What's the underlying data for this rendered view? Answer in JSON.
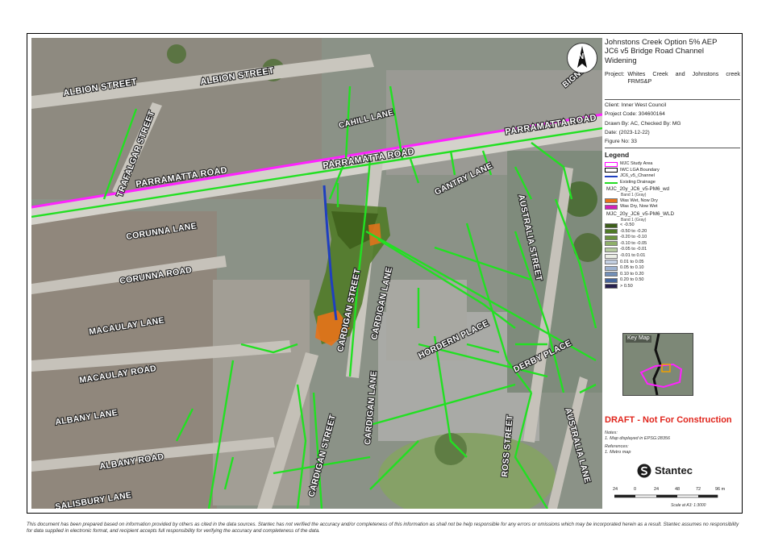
{
  "title": {
    "line1": "Johnstons Creek Option 5% AEP",
    "line2": "JC6 v5 Bridge Road Channel",
    "line3": "Widening"
  },
  "project": {
    "label": "Project:",
    "value": "Whites Creek and Johnstons creek FRMS&P"
  },
  "client": {
    "label": "Client:",
    "value": "Inner West Council"
  },
  "project_code": {
    "label": "Project Code:",
    "value": "304600164"
  },
  "drawn_by": {
    "label": "Drawn By:",
    "value": "AC, Checked By: MG"
  },
  "date": {
    "label": "Date:",
    "value": "(2023-12-22)"
  },
  "figure": {
    "label": "Figure No:",
    "value": "33"
  },
  "legend": {
    "title": "Legend",
    "items": [
      {
        "label": "MJC Study Area",
        "kind": "box",
        "color": "#ff00ff",
        "fill": "#ffffff"
      },
      {
        "label": "IWC LGA Boundary",
        "kind": "box",
        "color": "#000000",
        "fill": "#ffffff"
      },
      {
        "label": "JC6_v5_Channel",
        "kind": "line",
        "color": "#1f3fbf"
      },
      {
        "label": "Existing Drainage",
        "kind": "line",
        "color": "#22dd22"
      }
    ],
    "wd_group": {
      "name": "MJC_20y_JC6_v5-PM6_wd",
      "band": "Band 1 (Gray)",
      "items": [
        {
          "label": "Was Wet, Now Dry",
          "color": "#e8731a"
        },
        {
          "label": "Was Dry, Now Wet",
          "color": "#d21fb8"
        }
      ]
    },
    "wld_group": {
      "name": "MJC_20y_JC6_v5-PM6_WLD",
      "band": "Band 1 (Gray)",
      "items": [
        {
          "label": "< -0.50",
          "color": "#3d5e1a"
        },
        {
          "label": "-0.50 to -0.20",
          "color": "#4f7a26"
        },
        {
          "label": "-0.20 to -0.10",
          "color": "#6c9440"
        },
        {
          "label": "-0.10 to -0.05",
          "color": "#8fb06a"
        },
        {
          "label": "-0.05 to -0.01",
          "color": "#b7cca0"
        },
        {
          "label": "-0.01 to 0.01",
          "color": "#ecefe6"
        },
        {
          "label": "0.01 to 0.05",
          "color": "#c3d0e2"
        },
        {
          "label": "0.05 to 0.10",
          "color": "#9db2cf"
        },
        {
          "label": "0.10 to 0.20",
          "color": "#7390b8"
        },
        {
          "label": "0.20 to 0.50",
          "color": "#44649a"
        },
        {
          "label": "> 0.50",
          "color": "#26204e"
        }
      ]
    }
  },
  "key_map": {
    "title": "Key Map"
  },
  "draft": "DRAFT - Not For Construction",
  "notes": {
    "title": "Notes:",
    "text": "1. Map displayed in EPSG:28356"
  },
  "references": {
    "title": "References:",
    "text": "1. Metro map"
  },
  "brand": "Stantec",
  "scale_bar": {
    "ticks": [
      "24",
      "0",
      "24",
      "48",
      "72",
      "96 m"
    ],
    "caption": "Scale at A3: 1:3000"
  },
  "north_arrow": "N",
  "streets": {
    "albion_1": "ALBION STREET",
    "albion_2": "ALBION STREET",
    "trafalgar": "TRAFALGAR STREET",
    "cahill": "CAHILL LANE",
    "bignell": "BIGNELL",
    "parramatta_1": "PARRAMATTA ROAD",
    "parramatta_2": "PARRAMATTA ROAD",
    "parramatta_3": "PARRAMATTA ROAD",
    "gantry": "GANTRY LANE",
    "australia_street": "AUSTRALIA STREET",
    "corunna_lane": "CORUNNA LANE",
    "corunna_road": "CORUNNA ROAD",
    "cardigan_street_1": "CARDIGAN STREET",
    "cardigan_lane_1": "CARDIGAN LANE",
    "macaulay_lane": "MACAULAY LANE",
    "macaulay_road": "MACAULAY ROAD",
    "hordern": "HORDERN PLACE",
    "derby": "DERBY PLACE",
    "albany_lane": "ALBANY LANE",
    "albany_road": "ALBANY ROAD",
    "cardigan_street_2": "CARDIGAN STREET",
    "cardigan_lane_2": "CARDIGAN LANE",
    "ross": "ROSS STREET",
    "australia_lane": "AUSTRALIA LANE",
    "salisbury": "SALISBURY LANE"
  },
  "disclaimer": "This document has been prepared based on information provided by others as cited in the data sources. Stantec has not verified the accuracy and/or completeness of this information as shall not be help responsible for any errors or omissions which may be incorporated herein as a result. Stantec assumes no responsibility for data supplied in electronic format, and recipient accepts full responsibility for verifying the accuracy and completeness of the data."
}
